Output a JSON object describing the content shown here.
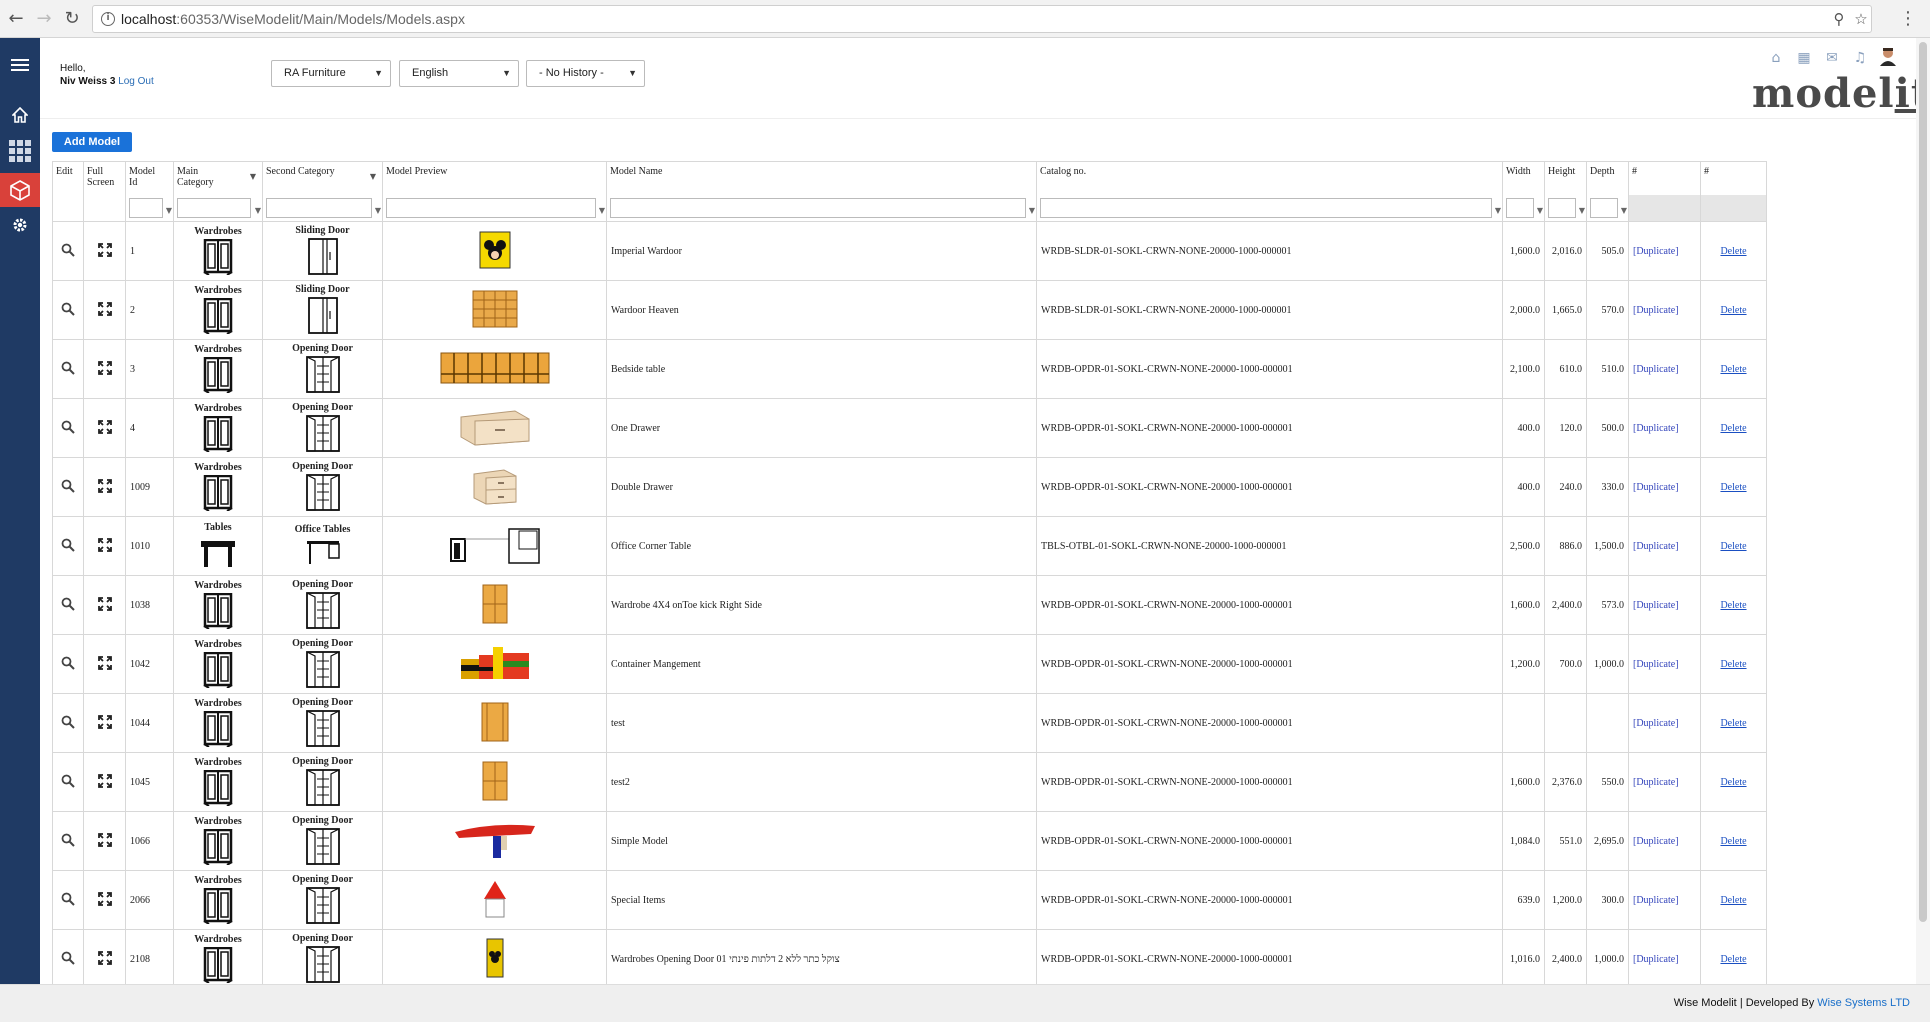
{
  "browser": {
    "url_host": "localhost",
    "url_rest": ":60353/WiseModelit/Main/Models/Models.aspx"
  },
  "header": {
    "hello": "Hello,",
    "user": "Niv Weiss 3",
    "logout": "Log Out",
    "company_select": "RA Furniture",
    "language_select": "English",
    "history_select": "- No History -",
    "logo_main": "model",
    "logo_it": "it"
  },
  "toolbar": {
    "add_model": "Add Model"
  },
  "columns": {
    "edit": "Edit",
    "full_screen_1": "Full",
    "full_screen_2": "Screen",
    "model_id_1": "Model",
    "model_id_2": "Id",
    "main_category_1": "Main",
    "main_category_2": "Category",
    "second_category": "Second Category",
    "model_preview": "Model Preview",
    "model_name": "Model Name",
    "catalog_no": "Catalog no.",
    "width": "Width",
    "height": "Height",
    "depth": "Depth",
    "hash1": "#",
    "hash2": "#"
  },
  "rows": [
    {
      "id": "1",
      "main": "Wardrobes",
      "second": "Sliding Door",
      "name": "Imperial Wardoor",
      "catalog": "WRDB-SLDR-01-SOKL-CRWN-NONE-20000-1000-000001",
      "width": "1,600.0",
      "height": "2,016.0",
      "depth": "505.0",
      "dup": "[Duplicate]",
      "del": "Delete",
      "preview": "mickey"
    },
    {
      "id": "2",
      "main": "Wardrobes",
      "second": "Sliding Door",
      "name": "Wardoor Heaven",
      "catalog": "WRDB-SLDR-01-SOKL-CRWN-NONE-20000-1000-000001",
      "width": "2,000.0",
      "height": "1,665.0",
      "depth": "570.0",
      "dup": "[Duplicate]",
      "del": "Delete",
      "preview": "grid"
    },
    {
      "id": "3",
      "main": "Wardrobes",
      "second": "Opening Door",
      "name": "Bedside table",
      "catalog": "WRDB-OPDR-01-SOKL-CRWN-NONE-20000-1000-000001",
      "width": "2,100.0",
      "height": "610.0",
      "depth": "510.0",
      "dup": "[Duplicate]",
      "del": "Delete",
      "preview": "long"
    },
    {
      "id": "4",
      "main": "Wardrobes",
      "second": "Opening Door",
      "name": "One Drawer",
      "catalog": "WRDB-OPDR-01-SOKL-CRWN-NONE-20000-1000-000001",
      "width": "400.0",
      "height": "120.0",
      "depth": "500.0",
      "dup": "[Duplicate]",
      "del": "Delete",
      "preview": "drawer1"
    },
    {
      "id": "1009",
      "main": "Wardrobes",
      "second": "Opening Door",
      "name": "Double Drawer",
      "catalog": "WRDB-OPDR-01-SOKL-CRWN-NONE-20000-1000-000001",
      "width": "400.0",
      "height": "240.0",
      "depth": "330.0",
      "dup": "[Duplicate]",
      "del": "Delete",
      "preview": "drawer2"
    },
    {
      "id": "1010",
      "main": "Tables",
      "second": "Office Tables",
      "name": "Office Corner Table",
      "catalog": "TBLS-OTBL-01-SOKL-CRWN-NONE-20000-1000-000001",
      "width": "2,500.0",
      "height": "886.0",
      "depth": "1,500.0",
      "dup": "[Duplicate]",
      "del": "Delete",
      "preview": "corner"
    },
    {
      "id": "1038",
      "main": "Wardrobes",
      "second": "Opening Door",
      "name": "Wardrobe 4X4 onToe kick Right Side",
      "catalog": "WRDB-OPDR-01-SOKL-CRWN-NONE-20000-1000-000001",
      "width": "1,600.0",
      "height": "2,400.0",
      "depth": "573.0",
      "dup": "[Duplicate]",
      "del": "Delete",
      "preview": "tall"
    },
    {
      "id": "1042",
      "main": "Wardrobes",
      "second": "Opening Door",
      "name": "Container Mangement",
      "catalog": "WRDB-OPDR-01-SOKL-CRWN-NONE-20000-1000-000001",
      "width": "1,200.0",
      "height": "700.0",
      "depth": "1,000.0",
      "dup": "[Duplicate]",
      "del": "Delete",
      "preview": "colorful"
    },
    {
      "id": "1044",
      "main": "Wardrobes",
      "second": "Opening Door",
      "name": "test",
      "catalog": "WRDB-OPDR-01-SOKL-CRWN-NONE-20000-1000-000001",
      "width": "",
      "height": "",
      "depth": "",
      "dup": "[Duplicate]",
      "del": "Delete",
      "preview": "narrow"
    },
    {
      "id": "1045",
      "main": "Wardrobes",
      "second": "Opening Door",
      "name": "test2",
      "catalog": "WRDB-OPDR-01-SOKL-CRWN-NONE-20000-1000-000001",
      "width": "1,600.0",
      "height": "2,376.0",
      "depth": "550.0",
      "dup": "[Duplicate]",
      "del": "Delete",
      "preview": "tall"
    },
    {
      "id": "1066",
      "main": "Wardrobes",
      "second": "Opening Door",
      "name": "Simple Model",
      "catalog": "WRDB-OPDR-01-SOKL-CRWN-NONE-20000-1000-000001",
      "width": "1,084.0",
      "height": "551.0",
      "depth": "2,695.0",
      "dup": "[Duplicate]",
      "del": "Delete",
      "preview": "redtable"
    },
    {
      "id": "2066",
      "main": "Wardrobes",
      "second": "Opening Door",
      "name": "Special Items",
      "catalog": "WRDB-OPDR-01-SOKL-CRWN-NONE-20000-1000-000001",
      "width": "639.0",
      "height": "1,200.0",
      "depth": "300.0",
      "dup": "[Duplicate]",
      "del": "Delete",
      "preview": "house"
    },
    {
      "id": "2108",
      "main": "Wardrobes",
      "second": "Opening Door",
      "name": "Wardrobes Opening Door 01 צוקל כתר ללא 2 דלתות פינתי",
      "catalog": "WRDB-OPDR-01-SOKL-CRWN-NONE-20000-1000-000001",
      "width": "1,016.0",
      "height": "2,400.0",
      "depth": "1,000.0",
      "dup": "[Duplicate]",
      "del": "Delete",
      "preview": "mickey2"
    }
  ],
  "footer": {
    "app": "Wise Modelit",
    "sep": "|",
    "dev": "Developed By",
    "company": "Wise Systems LTD"
  }
}
